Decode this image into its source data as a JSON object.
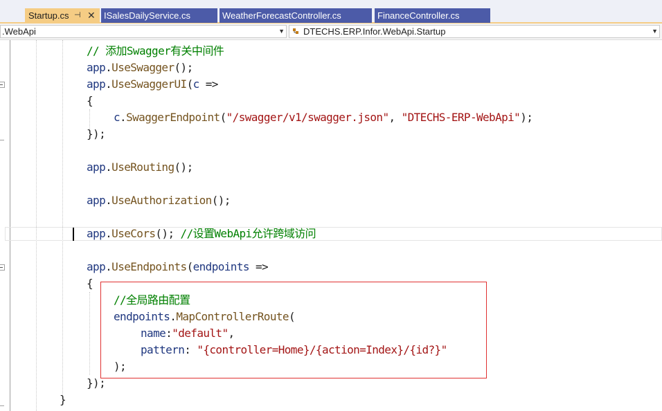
{
  "tabs": [
    {
      "label": "Startup.cs",
      "active": true,
      "pin": "⊣",
      "close": "✕"
    },
    {
      "label": "ISalesDailyService.cs",
      "active": false
    },
    {
      "label": "WeatherForecastController.cs",
      "active": false
    },
    {
      "label": "FinanceController.cs",
      "active": false
    }
  ],
  "nav": {
    "project": ".WebApi",
    "type": "DTECHS.ERP.Infor.WebApi.Startup",
    "dropdown_glyph": "▼"
  },
  "code": {
    "l1_comment": "// 添加Swagger有关中间件",
    "l2_obj": "app",
    "l2_dot": ".",
    "l2_method": "UseSwagger",
    "l2_end": "();",
    "l3_obj": "app",
    "l3_dot": ".",
    "l3_method": "UseSwaggerUI",
    "l3_open": "(",
    "l3_param": "c",
    "l3_arrow": " =>",
    "l4_brace": "{",
    "l5_obj": "c",
    "l5_dot": ".",
    "l5_method": "SwaggerEndpoint",
    "l5_open": "(",
    "l5_str1": "\"/swagger/v1/swagger.json\"",
    "l5_comma": ", ",
    "l5_str2": "\"DTECHS-ERP-WebApi\"",
    "l5_end": ");",
    "l6_end": "});",
    "l7_obj": "app",
    "l7_dot": ".",
    "l7_method": "UseRouting",
    "l7_end": "();",
    "l8_obj": "app",
    "l8_dot": ".",
    "l8_method": "UseAuthorization",
    "l8_end": "();",
    "l9_obj": "app",
    "l9_dot": ".",
    "l9_method": "UseCors",
    "l9_end": "(); ",
    "l9_comment": "//设置WebApi允许跨域访问",
    "l10_obj": "app",
    "l10_dot": ".",
    "l10_method": "UseEndpoints",
    "l10_open": "(",
    "l10_param": "endpoints",
    "l10_arrow": " =>",
    "l11_brace": "{",
    "l12_comment": "//全局路由配置",
    "l13_obj": "endpoints",
    "l13_dot": ".",
    "l13_method": "MapControllerRoute",
    "l13_open": "(",
    "l14_name": "name",
    "l14_colon": ":",
    "l14_str": "\"default\"",
    "l14_comma": ",",
    "l15_name": "pattern",
    "l15_colon": ": ",
    "l15_str": "\"{controller=Home}/{action=Index}/{id?}\"",
    "l16_end": ");",
    "l17_end": "});",
    "l18_brace": "}"
  }
}
